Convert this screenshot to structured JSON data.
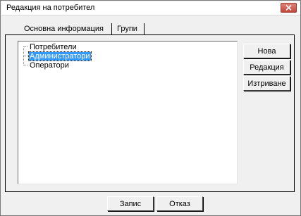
{
  "window": {
    "title": "Редакция на потребител"
  },
  "tabs": [
    {
      "label": "Основна информация"
    },
    {
      "label": "Групи"
    }
  ],
  "tree": {
    "items": [
      {
        "label": "Потребители",
        "selected": false
      },
      {
        "label": "Администратори",
        "selected": true
      },
      {
        "label": "Оператори",
        "selected": false
      }
    ]
  },
  "side_buttons": {
    "new": "Нова",
    "edit": "Редакция",
    "delete": "Изтриване"
  },
  "footer_buttons": {
    "save": "Запис",
    "cancel": "Отказ"
  },
  "colors": {
    "selection": "#3399ff",
    "close_button": "#c4463a"
  },
  "icons": {
    "close": "close-icon"
  }
}
